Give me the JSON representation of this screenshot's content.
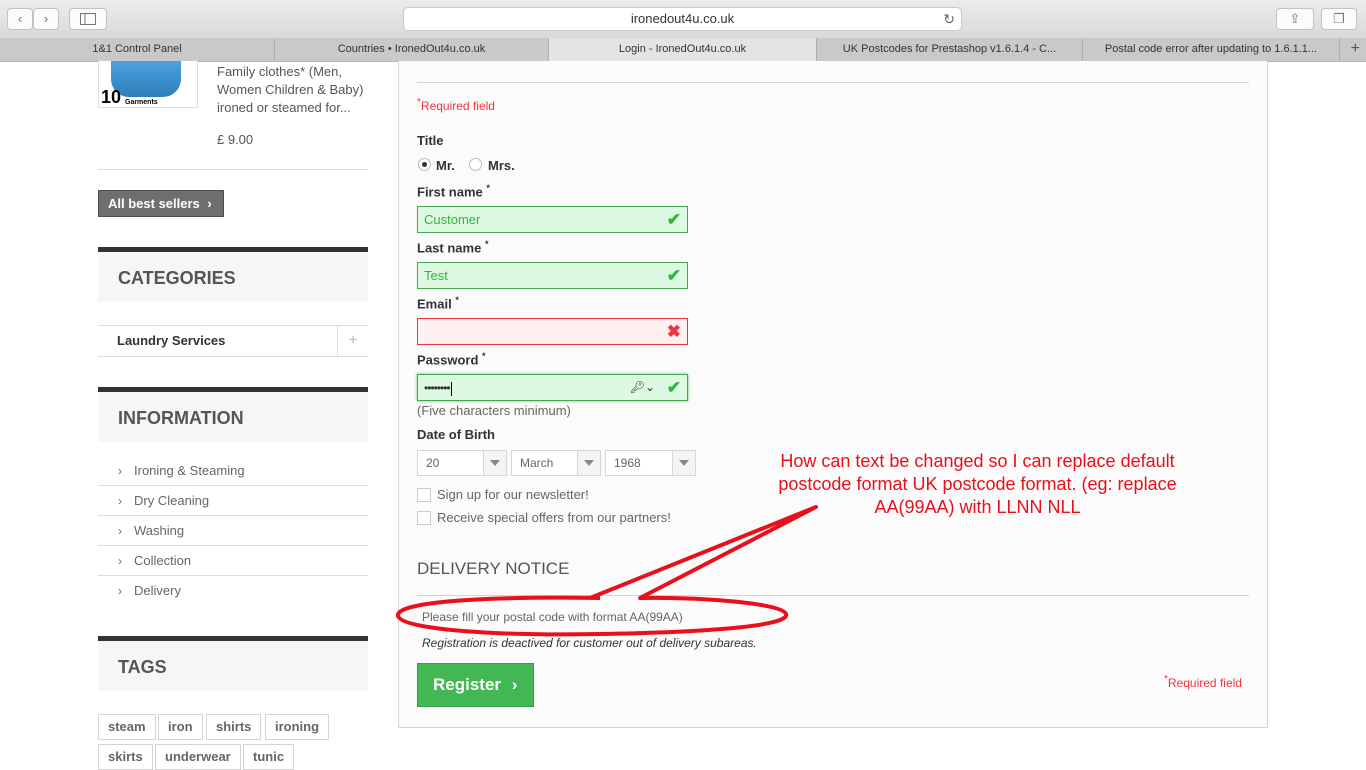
{
  "browser": {
    "url": "ironedout4u.co.uk",
    "tabs": [
      {
        "label": "1&1 Control Panel"
      },
      {
        "label": "Countries • IronedOut4u.co.uk"
      },
      {
        "label": "Login - IronedOut4u.co.uk"
      },
      {
        "label": "UK Postcodes for Prestashop v1.6.1.4 - C..."
      },
      {
        "label": "Postal code error after updating to 1.6.1.1..."
      }
    ],
    "icons": [
      "back-icon",
      "forward-icon",
      "sidebar-icon",
      "reload-icon",
      "share-icon",
      "tabs-overview-icon",
      "new-tab-icon"
    ]
  },
  "sidebar": {
    "product": {
      "thumb_number": "10",
      "thumb_caption": "Garments",
      "description": "Family clothes* (Men, Women Children & Baby) ironed or steamed for...",
      "price": "£ 9.00"
    },
    "all_best_sellers": "All best sellers",
    "categories_title": "CATEGORIES",
    "categories": [
      {
        "label": "Laundry Services"
      }
    ],
    "information_title": "INFORMATION",
    "information": [
      {
        "label": "Ironing & Steaming"
      },
      {
        "label": "Dry Cleaning"
      },
      {
        "label": "Washing"
      },
      {
        "label": "Collection"
      },
      {
        "label": "Delivery"
      }
    ],
    "tags_title": "TAGS",
    "tags": [
      {
        "label": "steam"
      },
      {
        "label": "iron"
      },
      {
        "label": "shirts"
      },
      {
        "label": "ironing"
      },
      {
        "label": "skirts"
      },
      {
        "label": "underwear"
      },
      {
        "label": "tunic"
      }
    ]
  },
  "form": {
    "required_note": "Required field",
    "required_mark": "*",
    "title_label": "Title",
    "title_options": [
      "Mr.",
      "Mrs."
    ],
    "title_selected": "Mr.",
    "first_name_label": "First name",
    "first_name_value": "Customer",
    "last_name_label": "Last name",
    "last_name_value": "Test",
    "email_label": "Email",
    "email_value": "",
    "password_label": "Password",
    "password_value": "••••••••",
    "password_hint": "(Five characters minimum)",
    "dob_label": "Date of Birth",
    "dob_day": "20",
    "dob_month": "March",
    "dob_year": "1968",
    "newsletter_label": "Sign up for our newsletter!",
    "offers_label": "Receive special offers from our partners!",
    "delivery_title": "DELIVERY NOTICE",
    "postal_notice": "Please fill your postal code with format AA(99AA)",
    "registration_notice": "Registration is deactived for customer out of delivery subareas.",
    "register_label": "Register",
    "bottom_required_note": "Required field"
  },
  "annotation": {
    "line1": "How can text be changed so I can replace default",
    "line2": "postcode format UK postcode format.  (eg: replace",
    "line3": "AA(99AA) with LLNN NLL",
    "color": "#e8101a"
  },
  "colors": {
    "valid_green": "#35b33f",
    "error_red": "#f13340",
    "register_green": "#43b754",
    "dark_button": "#6f6f6f"
  }
}
